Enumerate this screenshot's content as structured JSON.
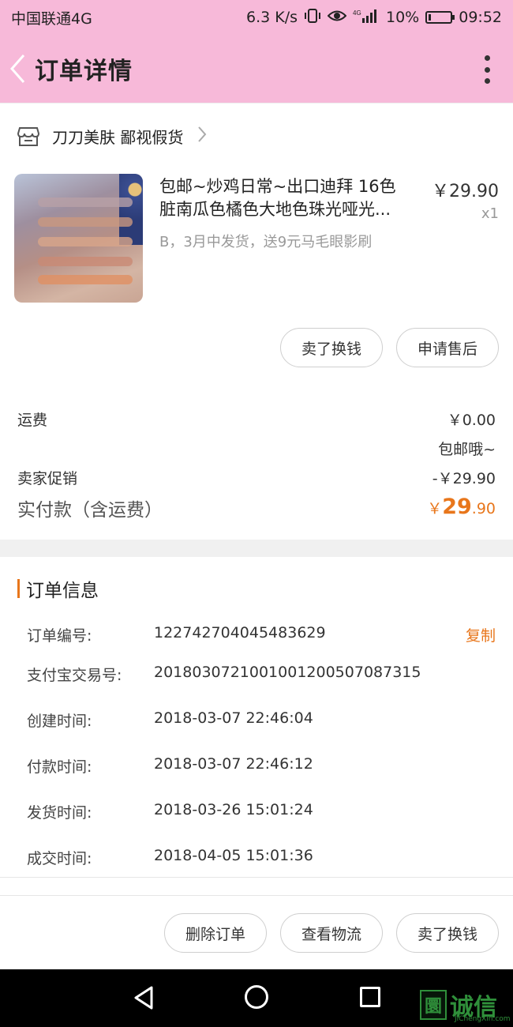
{
  "status_bar": {
    "carrier": "中国联通4G",
    "speed": "6.3 K/s",
    "battery": "10%",
    "time": "09:52"
  },
  "header": {
    "title": "订单详情"
  },
  "shop": {
    "name": "刀刀美肤 鄙视假货"
  },
  "item": {
    "title_line1": "包邮~炒鸡日常~出口迪拜 16色",
    "title_line2": "脏南瓜色橘色大地色珠光哑光...",
    "sku": "B，3月中发货，送9元马毛眼影刷",
    "price": "￥29.90",
    "qty": "x1",
    "buttons": [
      "卖了换钱",
      "申请售后"
    ]
  },
  "fees": {
    "shipping_label": "运费",
    "shipping_value": "￥0.00",
    "shipping_note": "包邮哦~",
    "promo_label": "卖家促销",
    "promo_value": "-￥29.90",
    "paid_label": "实付款（含运费）",
    "paid_currency": "￥",
    "paid_integer": "29",
    "paid_decimal": ".90"
  },
  "order_info": {
    "title": "订单信息",
    "copy_label": "复制",
    "rows": [
      {
        "label": "订单编号:",
        "value": "122742704045483629"
      },
      {
        "label": "支付宝交易号:",
        "value": "2018030721001001200507087315"
      },
      {
        "label": "创建时间:",
        "value": "2018-03-07 22:46:04"
      },
      {
        "label": "付款时间:",
        "value": "2018-03-07 22:46:12"
      },
      {
        "label": "发货时间:",
        "value": "2018-03-26 15:01:24"
      },
      {
        "label": "成交时间:",
        "value": "2018-04-05 15:01:36"
      }
    ]
  },
  "actions": {
    "buttons": [
      "删除订单",
      "查看物流",
      "卖了换钱"
    ]
  },
  "watermark": {
    "box": "圜",
    "text": "诚信",
    "sub": "JiChengXin.com"
  },
  "colors": {
    "header_bg": "#f7b9d9",
    "accent": "#e8761b"
  }
}
